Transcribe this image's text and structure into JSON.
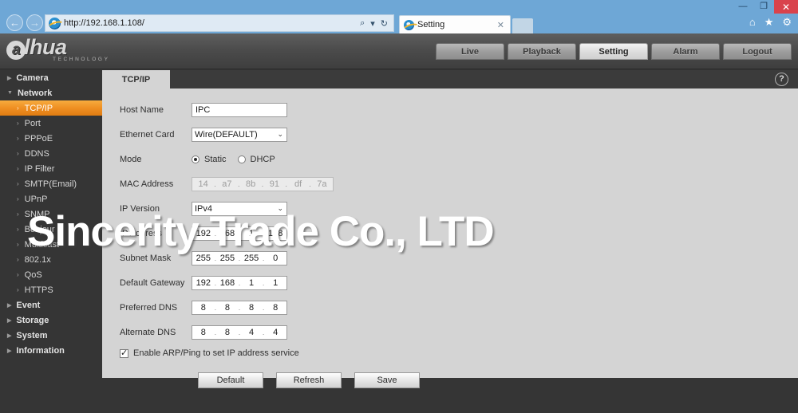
{
  "browser": {
    "url": "http://192.168.1.108/",
    "url_icon": "ie-favicon",
    "back_icon": "←",
    "forward_icon": "→",
    "search_icon": "⌕",
    "search_caret": "▾",
    "refresh_icon": "↻",
    "tab_title": "Setting",
    "tab_close": "✕",
    "home_icon": "⌂",
    "favorites_icon": "★",
    "tools_icon": "⚙",
    "minimize": "—",
    "maximize": "❐",
    "close": "✕"
  },
  "header": {
    "logo_at": "a",
    "logo_word": "lhua",
    "logo_sub": "TECHNOLOGY",
    "nav": [
      {
        "label": "Live",
        "active": false
      },
      {
        "label": "Playback",
        "active": false
      },
      {
        "label": "Setting",
        "active": true
      },
      {
        "label": "Alarm",
        "active": false
      },
      {
        "label": "Logout",
        "active": false
      }
    ]
  },
  "sidebar": {
    "expand_icon": "▶",
    "collapse_icon": "▼",
    "chevron_icon": "›",
    "items": [
      {
        "label": "Camera",
        "type": "group",
        "expanded": false
      },
      {
        "label": "Network",
        "type": "group",
        "expanded": true
      },
      {
        "label": "TCP/IP",
        "type": "item",
        "active": true
      },
      {
        "label": "Port",
        "type": "item",
        "active": false
      },
      {
        "label": "PPPoE",
        "type": "item",
        "active": false
      },
      {
        "label": "DDNS",
        "type": "item",
        "active": false
      },
      {
        "label": "IP Filter",
        "type": "item",
        "active": false
      },
      {
        "label": "SMTP(Email)",
        "type": "item",
        "active": false
      },
      {
        "label": "UPnP",
        "type": "item",
        "active": false
      },
      {
        "label": "SNMP",
        "type": "item",
        "active": false
      },
      {
        "label": "Bonjour",
        "type": "item",
        "active": false
      },
      {
        "label": "Multicast",
        "type": "item",
        "active": false
      },
      {
        "label": "802.1x",
        "type": "item",
        "active": false
      },
      {
        "label": "QoS",
        "type": "item",
        "active": false
      },
      {
        "label": "HTTPS",
        "type": "item",
        "active": false
      },
      {
        "label": "Event",
        "type": "group",
        "expanded": false
      },
      {
        "label": "Storage",
        "type": "group",
        "expanded": false
      },
      {
        "label": "System",
        "type": "group",
        "expanded": false
      },
      {
        "label": "Information",
        "type": "group",
        "expanded": false
      }
    ]
  },
  "content": {
    "tab_label": "TCP/IP",
    "help_icon": "?",
    "form": {
      "host_name_label": "Host Name",
      "host_name_value": "IPC",
      "ethernet_card_label": "Ethernet Card",
      "ethernet_card_value": "Wire(DEFAULT)",
      "mode_label": "Mode",
      "mode_static": "Static",
      "mode_dhcp": "DHCP",
      "mode_selected": "Static",
      "mac_label": "MAC Address",
      "mac_octets": [
        "14",
        "a7",
        "8b",
        "91",
        "df",
        "7a"
      ],
      "ip_version_label": "IP Version",
      "ip_version_value": "IPv4",
      "ip_address_label": "IP Address",
      "ip_address_octets": [
        "192",
        "168",
        "1",
        "108"
      ],
      "subnet_label": "Subnet Mask",
      "subnet_octets": [
        "255",
        "255",
        "255",
        "0"
      ],
      "gateway_label": "Default Gateway",
      "gateway_octets": [
        "192",
        "168",
        "1",
        "1"
      ],
      "preferred_dns_label": "Preferred DNS",
      "preferred_dns_octets": [
        "8",
        "8",
        "8",
        "8"
      ],
      "alternate_dns_label": "Alternate DNS",
      "alternate_dns_octets": [
        "8",
        "8",
        "4",
        "4"
      ],
      "arp_ping_label": "Enable ARP/Ping to set IP address service",
      "arp_ping_checked": true,
      "caret_icon": "⌄",
      "separator": "."
    },
    "buttons": [
      {
        "label": "Default"
      },
      {
        "label": "Refresh"
      },
      {
        "label": "Save"
      }
    ]
  },
  "watermark": {
    "text": "Sincerity Trade Co., LTD"
  },
  "colors": {
    "accent_orange": "#ef8f22",
    "sidebar_bg": "#353535",
    "panel_bg": "#d4d4d4",
    "browser_blue": "#6ea7d6",
    "close_red": "#d9434c"
  }
}
